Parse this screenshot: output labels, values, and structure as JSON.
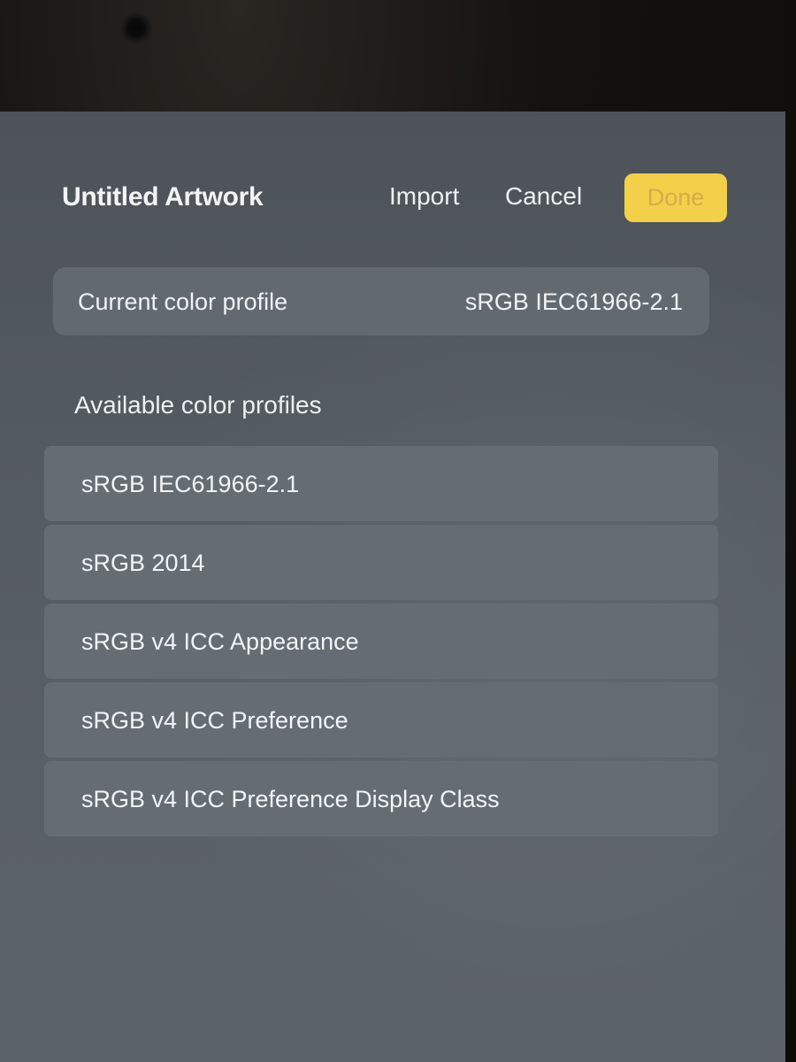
{
  "header": {
    "title": "Untitled Artwork",
    "import_label": "Import",
    "cancel_label": "Cancel",
    "done_label": "Done"
  },
  "current_profile": {
    "label": "Current color profile",
    "value": "sRGB IEC61966-2.1"
  },
  "available": {
    "heading": "Available color profiles",
    "items": [
      {
        "label": "sRGB IEC61966-2.1"
      },
      {
        "label": "sRGB 2014"
      },
      {
        "label": "sRGB v4 ICC Appearance"
      },
      {
        "label": "sRGB v4 ICC Preference"
      },
      {
        "label": "sRGB v4 ICC Preference Display Class"
      }
    ]
  },
  "colors": {
    "accent": "#f2d04a",
    "panel": "#535a60",
    "row": "#656d73"
  }
}
